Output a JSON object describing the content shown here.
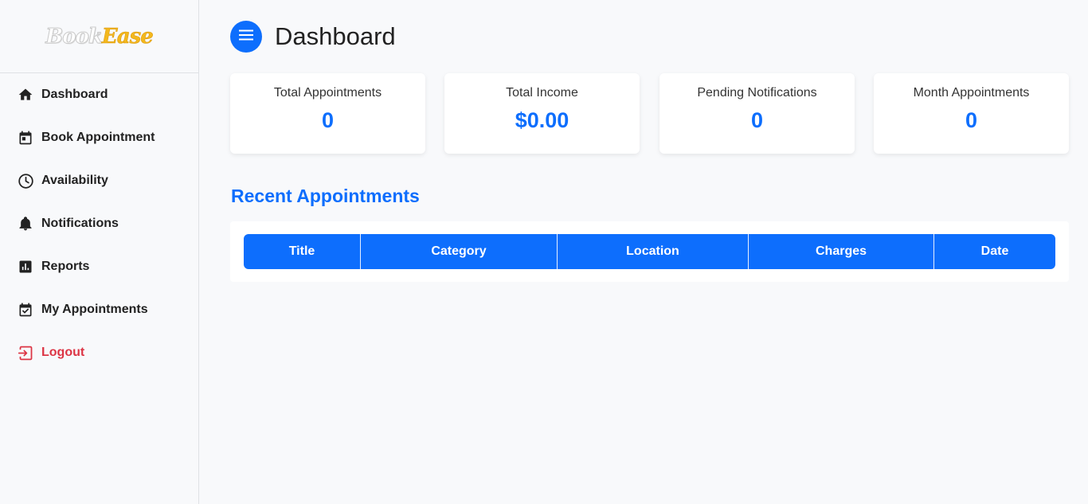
{
  "brand": {
    "logo_part1": "Book",
    "logo_part2": "Ease"
  },
  "sidebar": {
    "items": [
      {
        "label": "Dashboard",
        "icon": "home-icon"
      },
      {
        "label": "Book Appointment",
        "icon": "calendar-icon"
      },
      {
        "label": "Availability",
        "icon": "clock-icon"
      },
      {
        "label": "Notifications",
        "icon": "bell-icon"
      },
      {
        "label": "Reports",
        "icon": "report-icon"
      },
      {
        "label": "My Appointments",
        "icon": "calendar-check-icon"
      },
      {
        "label": "Logout",
        "icon": "logout-icon"
      }
    ]
  },
  "header": {
    "title": "Dashboard",
    "menu_icon": "hamburger-menu-icon"
  },
  "stats": [
    {
      "label": "Total Appointments",
      "value": "0"
    },
    {
      "label": "Total Income",
      "value": "$0.00"
    },
    {
      "label": "Pending Notifications",
      "value": "0"
    },
    {
      "label": "Month Appointments",
      "value": "0"
    }
  ],
  "recent": {
    "title": "Recent Appointments",
    "columns": [
      "Title",
      "Category",
      "Location",
      "Charges",
      "Date"
    ],
    "rows": []
  },
  "colors": {
    "primary": "#0d6efd",
    "danger": "#dc3545",
    "logo_accent": "#f3b81d",
    "background": "#f8f9fb"
  }
}
